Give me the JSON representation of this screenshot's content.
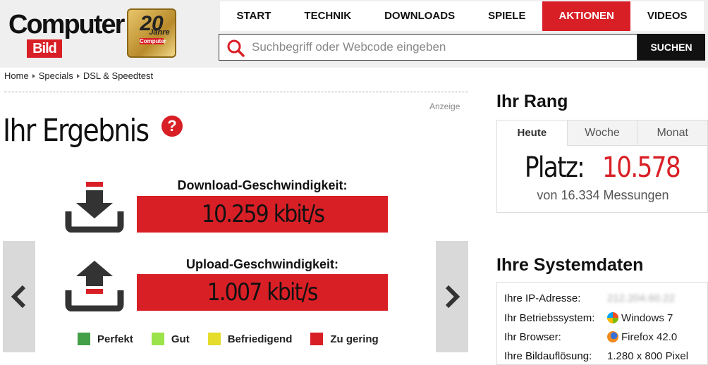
{
  "brand": {
    "word1": "Computer",
    "word2": "Bild"
  },
  "badge": {
    "number": "20",
    "word": "Jahre",
    "sub": "Computer"
  },
  "nav": [
    {
      "label": "START",
      "active": false
    },
    {
      "label": "TECHNIK",
      "active": false
    },
    {
      "label": "DOWNLOADS",
      "active": false
    },
    {
      "label": "SPIELE",
      "active": false
    },
    {
      "label": "AKTIONEN",
      "active": true
    },
    {
      "label": "VIDEOS",
      "active": false
    }
  ],
  "search": {
    "placeholder": "Suchbegriff oder Webcode eingeben",
    "button": "SUCHEN"
  },
  "breadcrumb": [
    "Home",
    "Specials",
    "DSL & Speedtest"
  ],
  "ad_label": "Anzeige",
  "result": {
    "title": "Ihr Ergebnis",
    "help": "?",
    "download_label": "Download-Geschwindigkeit:",
    "download_value": "10.259 kbit/s",
    "upload_label": "Upload-Geschwindigkeit:",
    "upload_value": "1.007 kbit/s"
  },
  "legend": [
    {
      "label": "Perfekt",
      "color": "#43a047"
    },
    {
      "label": "Gut",
      "color": "#9be34a"
    },
    {
      "label": "Befriedigend",
      "color": "#e6dc2c"
    },
    {
      "label": "Zu gering",
      "color": "#d91f26"
    }
  ],
  "rank": {
    "heading": "Ihr Rang",
    "tabs": [
      "Heute",
      "Woche",
      "Monat"
    ],
    "place_label": "Platz:",
    "place_value": "10.578",
    "sub": "von 16.334 Messungen"
  },
  "system": {
    "heading": "Ihre Systemdaten",
    "rows": [
      {
        "key": "Ihre IP-Adresse:",
        "value": "212.204.60.22"
      },
      {
        "key": "Ihr Betriebssystem:",
        "value": "Windows 7"
      },
      {
        "key": "Ihr Browser:",
        "value": "Firefox 42.0"
      },
      {
        "key": "Ihre Bildauflösung:",
        "value": "1.280 x 800 Pixel"
      }
    ]
  },
  "colors": {
    "accent": "#d91f26",
    "header_bg": "#efefef",
    "panel_gray": "#d9d9d9",
    "icon_dark": "#333333"
  },
  "icons": {
    "search": "magnifier-icon",
    "download": "download-tray-icon",
    "upload": "upload-tray-icon",
    "prev": "chevron-left-icon",
    "next": "chevron-right-icon",
    "os": "windows-logo-icon",
    "browser": "firefox-logo-icon"
  }
}
